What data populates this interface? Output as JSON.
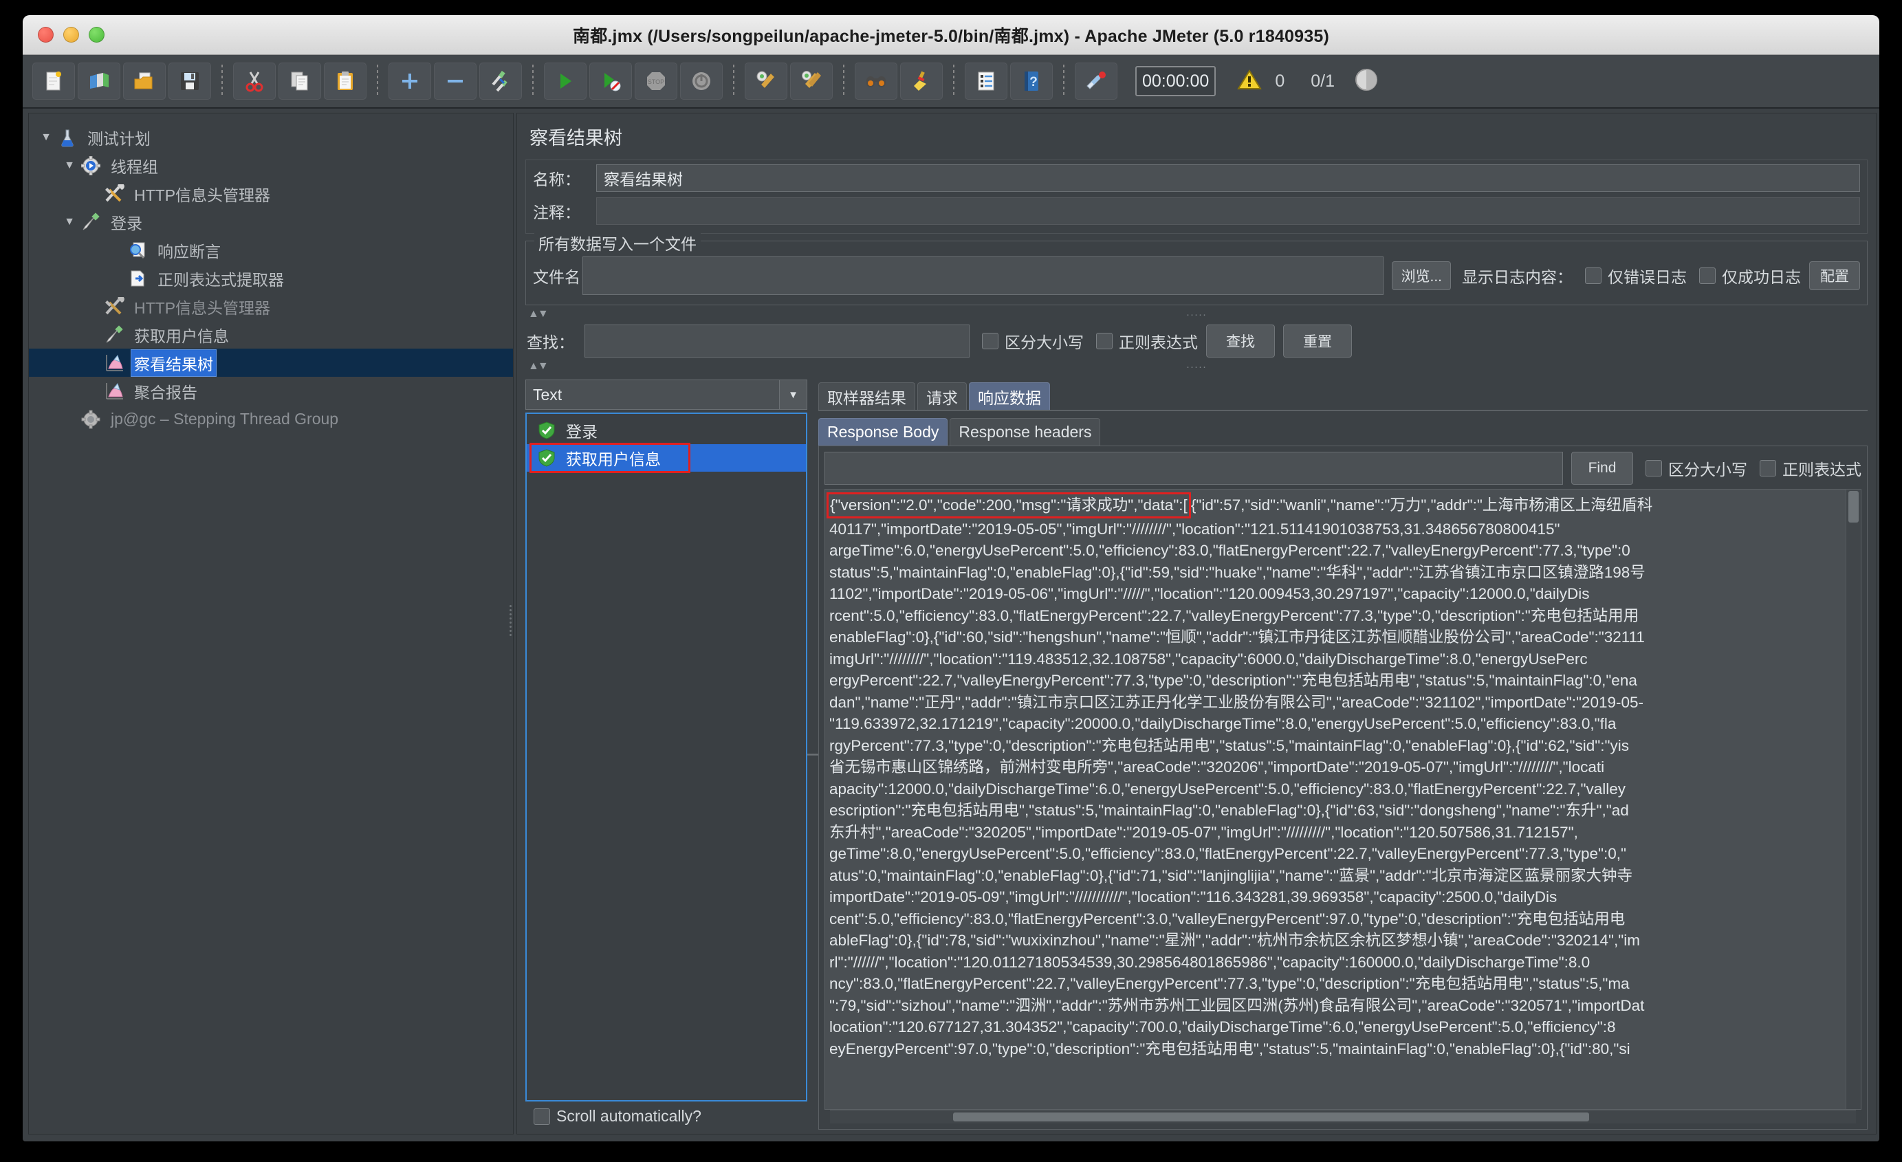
{
  "window": {
    "title": "南都.jmx (/Users/songpeilun/apache-jmeter-5.0/bin/南都.jmx) - Apache JMeter (5.0 r1840935)"
  },
  "toolbar": {
    "buttons": [
      {
        "name": "new-icon",
        "glyph": "🗒"
      },
      {
        "name": "templates-icon",
        "glyph": "📚"
      },
      {
        "name": "open-icon",
        "glyph": "📂"
      },
      {
        "name": "save-icon",
        "glyph": "💾"
      },
      {
        "name": "cut-icon",
        "glyph": "✂"
      },
      {
        "name": "copy-icon",
        "glyph": "📄"
      },
      {
        "name": "paste-icon",
        "glyph": "📋"
      },
      {
        "name": "expand-all-icon",
        "glyph": "+"
      },
      {
        "name": "collapse-all-icon",
        "glyph": "−"
      },
      {
        "name": "toggle-icon",
        "glyph": "🖊"
      },
      {
        "name": "start-icon",
        "glyph": "▶"
      },
      {
        "name": "start-no-pauses-icon",
        "glyph": "▶"
      },
      {
        "name": "stop-icon",
        "glyph": "STOP"
      },
      {
        "name": "shutdown-icon",
        "glyph": "⏻"
      },
      {
        "name": "clear-icon",
        "glyph": "🧹"
      },
      {
        "name": "clear-all-icon",
        "glyph": "🧹"
      },
      {
        "name": "search-icon",
        "glyph": "🔭"
      },
      {
        "name": "reset-search-icon",
        "glyph": "🧹"
      },
      {
        "name": "function-helper-icon",
        "glyph": "📑"
      },
      {
        "name": "help-icon",
        "glyph": "?"
      },
      {
        "name": "undo-redo-icon",
        "glyph": "🎏"
      }
    ],
    "timer": "00:00:00",
    "warning_count": "0",
    "thread_count": "0/1"
  },
  "tree": {
    "nodes": [
      {
        "label": "测试计划",
        "indent": 0,
        "twist": "▼",
        "icon": "flask-icon",
        "selected": false,
        "dim": false
      },
      {
        "label": "线程组",
        "indent": 1,
        "twist": "▼",
        "icon": "thread-group-icon",
        "selected": false,
        "dim": false
      },
      {
        "label": "HTTP信息头管理器",
        "indent": 2,
        "twist": "",
        "icon": "header-manager-icon",
        "selected": false,
        "dim": false
      },
      {
        "label": "登录",
        "indent": 2,
        "twist": "▼",
        "icon": "http-sampler-icon",
        "selected": false,
        "dim": false
      },
      {
        "label": "响应断言",
        "indent": 3,
        "twist": "",
        "icon": "assertion-icon",
        "selected": false,
        "dim": false
      },
      {
        "label": "正则表达式提取器",
        "indent": 3,
        "twist": "",
        "icon": "regex-extractor-icon",
        "selected": false,
        "dim": false
      },
      {
        "label": "HTTP信息头管理器",
        "indent": 2,
        "twist": "",
        "icon": "header-manager-icon",
        "selected": false,
        "dim": true
      },
      {
        "label": "获取用户信息",
        "indent": 2,
        "twist": "",
        "icon": "http-sampler-icon",
        "selected": false,
        "dim": false
      },
      {
        "label": "察看结果树",
        "indent": 2,
        "twist": "",
        "icon": "view-results-tree-icon",
        "selected": true,
        "dim": false
      },
      {
        "label": "聚合报告",
        "indent": 2,
        "twist": "",
        "icon": "aggregate-report-icon",
        "selected": false,
        "dim": false
      },
      {
        "label": "jp@gc – Stepping Thread Group",
        "indent": 1,
        "twist": "",
        "icon": "stepping-thread-group-icon",
        "selected": false,
        "dim": true
      }
    ]
  },
  "panel": {
    "title": "察看结果树",
    "name_label": "名称：",
    "name_value": "察看结果树",
    "comment_label": "注释：",
    "comment_value": "",
    "file_group_legend": "所有数据写入一个文件",
    "filename_label": "文件名",
    "filename_value": "",
    "browse_button": "浏览...",
    "log_display_label": "显示日志内容：",
    "errors_only_label": "仅错误日志",
    "successes_only_label": "仅成功日志",
    "configure_button": "配置",
    "search_label": "查找：",
    "search_value": "",
    "case_sensitive_label": "区分大小写",
    "regex_label": "正则表达式",
    "search_button": "查找",
    "reset_button": "重置"
  },
  "results": {
    "renderer_selected": "Text",
    "items": [
      {
        "label": "登录",
        "active": false,
        "highlighted": false
      },
      {
        "label": "获取用户信息",
        "active": true,
        "highlighted": true
      }
    ],
    "scroll_auto_label": "Scroll automatically?"
  },
  "tabs": {
    "main": [
      {
        "label": "取样器结果",
        "selected": false
      },
      {
        "label": "请求",
        "selected": false
      },
      {
        "label": "响应数据",
        "selected": true
      }
    ],
    "sub": [
      {
        "label": "Response Body",
        "selected": true
      },
      {
        "label": "Response headers",
        "selected": false
      }
    ],
    "find_value": "",
    "find_button": "Find",
    "case_sensitive_label": "区分大小写",
    "regex_label": "正则表达式"
  },
  "response_body": {
    "highlighted_first_segment": "{\"version\":\"2.0\",\"code\":200,\"msg\":\"请求成功\",\"data\":[",
    "first_line_rest": "{\"id\":57,\"sid\":\"wanli\",\"name\":\"万力\",\"addr\":\"上海市杨浦区上海纽盾科",
    "lines": [
      "40117\",\"importDate\":\"2019-05-05\",\"imgUrl\":\"////////\",\"location\":\"121.51141901038753,31.348656780800415\"",
      "argeTime\":6.0,\"energyUsePercent\":5.0,\"efficiency\":83.0,\"flatEnergyPercent\":22.7,\"valleyEnergyPercent\":77.3,\"type\":0",
      "status\":5,\"maintainFlag\":0,\"enableFlag\":0},{\"id\":59,\"sid\":\"huake\",\"name\":\"华科\",\"addr\":\"江苏省镇江市京口区镇澄路198号",
      "1102\",\"importDate\":\"2019-05-06\",\"imgUrl\":\"/////\",\"location\":\"120.009453,30.297197\",\"capacity\":12000.0,\"dailyDis",
      "rcent\":5.0,\"efficiency\":83.0,\"flatEnergyPercent\":22.7,\"valleyEnergyPercent\":77.3,\"type\":0,\"description\":\"充电包括站用用",
      "enableFlag\":0},{\"id\":60,\"sid\":\"hengshun\",\"name\":\"恒顺\",\"addr\":\"镇江市丹徒区江苏恒顺醋业股份公司\",\"areaCode\":\"32111",
      "imgUrl\":\"////////\",\"location\":\"119.483512,32.108758\",\"capacity\":6000.0,\"dailyDischargeTime\":8.0,\"energyUsePerc",
      "ergyPercent\":22.7,\"valleyEnergyPercent\":77.3,\"type\":0,\"description\":\"充电包括站用电\",\"status\":5,\"maintainFlag\":0,\"ena",
      "dan\",\"name\":\"正丹\",\"addr\":\"镇江市京口区江苏正丹化学工业股份有限公司\",\"areaCode\":\"321102\",\"importDate\":\"2019-05-",
      "\"119.633972,32.171219\",\"capacity\":20000.0,\"dailyDischargeTime\":8.0,\"energyUsePercent\":5.0,\"efficiency\":83.0,\"fla",
      "rgyPercent\":77.3,\"type\":0,\"description\":\"充电包括站用电\",\"status\":5,\"maintainFlag\":0,\"enableFlag\":0},{\"id\":62,\"sid\":\"yis",
      "省无锡市惠山区锦绣路，前洲村变电所旁\",\"areaCode\":\"320206\",\"importDate\":\"2019-05-07\",\"imgUrl\":\"////////\",\"locati",
      "apacity\":12000.0,\"dailyDischargeTime\":6.0,\"energyUsePercent\":5.0,\"efficiency\":83.0,\"flatEnergyPercent\":22.7,\"valley",
      "escription\":\"充电包括站用电\",\"status\":5,\"maintainFlag\":0,\"enableFlag\":0},{\"id\":63,\"sid\":\"dongsheng\",\"name\":\"东升\",\"ad",
      "东升村\",\"areaCode\":\"320205\",\"importDate\":\"2019-05-07\",\"imgUrl\":\"/////////\",\"location\":\"120.507586,31.712157\",",
      "geTime\":8.0,\"energyUsePercent\":5.0,\"efficiency\":83.0,\"flatEnergyPercent\":22.7,\"valleyEnergyPercent\":77.3,\"type\":0,\"",
      "atus\":0,\"maintainFlag\":0,\"enableFlag\":0},{\"id\":71,\"sid\":\"lanjinglijia\",\"name\":\"蓝景\",\"addr\":\"北京市海淀区蓝景丽家大钟寺",
      "importDate\":\"2019-05-09\",\"imgUrl\":\"///////////\",\"location\":\"116.343281,39.969358\",\"capacity\":2500.0,\"dailyDis",
      "cent\":5.0,\"efficiency\":83.0,\"flatEnergyPercent\":3.0,\"valleyEnergyPercent\":97.0,\"type\":0,\"description\":\"充电包括站用电",
      "ableFlag\":0},{\"id\":78,\"sid\":\"wuxixinzhou\",\"name\":\"星洲\",\"addr\":\"杭州市余杭区余杭区梦想小镇\",\"areaCode\":\"320214\",\"im",
      "rl\":\"//////\",\"location\":\"120.01127180534539,30.298564801865986\",\"capacity\":160000.0,\"dailyDischargeTime\":8.0",
      "ncy\":83.0,\"flatEnergyPercent\":22.7,\"valleyEnergyPercent\":77.3,\"type\":0,\"description\":\"充电包括站用电\",\"status\":5,\"ma",
      "\":79,\"sid\":\"sizhou\",\"name\":\"泗洲\",\"addr\":\"苏州市苏州工业园区四洲(苏州)食品有限公司\",\"areaCode\":\"320571\",\"importDat",
      "location\":\"120.677127,31.304352\",\"capacity\":700.0,\"dailyDischargeTime\":6.0,\"energyUsePercent\":5.0,\"efficiency\":8",
      "eyEnergyPercent\":97.0,\"type\":0,\"description\":\"充电包括站用电\",\"status\":5,\"maintainFlag\":0,\"enableFlag\":0},{\"id\":80,\"si"
    ]
  },
  "colors": {
    "accent_blue": "#2a6cd4",
    "highlight_red": "#e02020",
    "tab_selected": "#5a6a88",
    "panel_bg": "#3c4145"
  }
}
